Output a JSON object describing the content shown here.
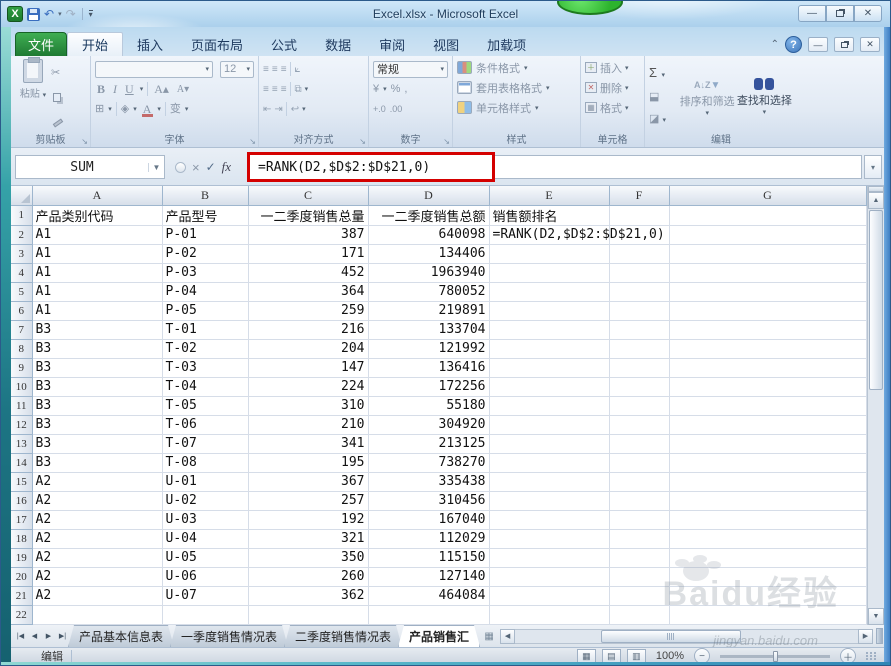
{
  "window": {
    "title": "Excel.xlsx - Microsoft Excel"
  },
  "ribbon": {
    "tabs": [
      {
        "label": "文件",
        "type": "file"
      },
      {
        "label": "开始",
        "active": true
      },
      {
        "label": "插入"
      },
      {
        "label": "页面布局"
      },
      {
        "label": "公式"
      },
      {
        "label": "数据"
      },
      {
        "label": "审阅"
      },
      {
        "label": "视图"
      },
      {
        "label": "加载项"
      }
    ],
    "clipboard": {
      "label": "剪贴板",
      "paste_label": "粘贴"
    },
    "font": {
      "label": "字体",
      "size": "12",
      "bold": "B",
      "italic": "I",
      "underline": "U",
      "color_letter": "A",
      "phonetic": "变"
    },
    "alignment": {
      "label": "对齐方式"
    },
    "number": {
      "label": "数字",
      "format": "常规",
      "currency": "¥",
      "percent": "%",
      "comma": ",",
      "inc_decimal": "+.0",
      "dec_decimal": ".00"
    },
    "styles": {
      "label": "样式",
      "items": [
        "条件格式",
        "套用表格格式",
        "单元格样式"
      ]
    },
    "cells": {
      "label": "单元格",
      "items": [
        "插入",
        "删除",
        "格式"
      ]
    },
    "editing": {
      "label": "编辑",
      "sum": "Σ",
      "sort_label": "排序和筛选",
      "find_label": "查找和选择"
    }
  },
  "formula_bar": {
    "name_box": "SUM",
    "formula": "=RANK(D2,$D$2:$D$21,0)",
    "fx_label": "fx"
  },
  "grid": {
    "column_headers": [
      "A",
      "B",
      "C",
      "D",
      "E",
      "F",
      "G"
    ],
    "numeric_columns": [
      2,
      3
    ],
    "rows": [
      {
        "n": 1,
        "cells": [
          "产品类别代码",
          "产品型号",
          "一二季度销售总量",
          "一二季度销售总额",
          "销售额排名",
          "",
          ""
        ]
      },
      {
        "n": 2,
        "cells": [
          "A1",
          "P-01",
          "387",
          "640098",
          "=RANK(D2,$D$2:$D$21,0)",
          "",
          ""
        ]
      },
      {
        "n": 3,
        "cells": [
          "A1",
          "P-02",
          "171",
          "134406",
          "",
          "",
          ""
        ]
      },
      {
        "n": 4,
        "cells": [
          "A1",
          "P-03",
          "452",
          "1963940",
          "",
          "",
          ""
        ]
      },
      {
        "n": 5,
        "cells": [
          "A1",
          "P-04",
          "364",
          "780052",
          "",
          "",
          ""
        ]
      },
      {
        "n": 6,
        "cells": [
          "A1",
          "P-05",
          "259",
          "219891",
          "",
          "",
          ""
        ]
      },
      {
        "n": 7,
        "cells": [
          "B3",
          "T-01",
          "216",
          "133704",
          "",
          "",
          ""
        ]
      },
      {
        "n": 8,
        "cells": [
          "B3",
          "T-02",
          "204",
          "121992",
          "",
          "",
          ""
        ]
      },
      {
        "n": 9,
        "cells": [
          "B3",
          "T-03",
          "147",
          "136416",
          "",
          "",
          ""
        ]
      },
      {
        "n": 10,
        "cells": [
          "B3",
          "T-04",
          "224",
          "172256",
          "",
          "",
          ""
        ]
      },
      {
        "n": 11,
        "cells": [
          "B3",
          "T-05",
          "310",
          "55180",
          "",
          "",
          ""
        ]
      },
      {
        "n": 12,
        "cells": [
          "B3",
          "T-06",
          "210",
          "304920",
          "",
          "",
          ""
        ]
      },
      {
        "n": 13,
        "cells": [
          "B3",
          "T-07",
          "341",
          "213125",
          "",
          "",
          ""
        ]
      },
      {
        "n": 14,
        "cells": [
          "B3",
          "T-08",
          "195",
          "738270",
          "",
          "",
          ""
        ]
      },
      {
        "n": 15,
        "cells": [
          "A2",
          "U-01",
          "367",
          "335438",
          "",
          "",
          ""
        ]
      },
      {
        "n": 16,
        "cells": [
          "A2",
          "U-02",
          "257",
          "310456",
          "",
          "",
          ""
        ]
      },
      {
        "n": 17,
        "cells": [
          "A2",
          "U-03",
          "192",
          "167040",
          "",
          "",
          ""
        ]
      },
      {
        "n": 18,
        "cells": [
          "A2",
          "U-04",
          "321",
          "112029",
          "",
          "",
          ""
        ]
      },
      {
        "n": 19,
        "cells": [
          "A2",
          "U-05",
          "350",
          "115150",
          "",
          "",
          ""
        ]
      },
      {
        "n": 20,
        "cells": [
          "A2",
          "U-06",
          "260",
          "127140",
          "",
          "",
          ""
        ]
      },
      {
        "n": 21,
        "cells": [
          "A2",
          "U-07",
          "362",
          "464084",
          "",
          "",
          ""
        ]
      },
      {
        "n": 22,
        "cells": [
          "",
          "",
          "",
          "",
          "",
          "",
          ""
        ]
      }
    ]
  },
  "sheet_bar": {
    "tabs": [
      {
        "label": "产品基本信息表"
      },
      {
        "label": "一季度销售情况表"
      },
      {
        "label": "二季度销售情况表"
      },
      {
        "label": "产品销售汇",
        "active": true
      }
    ]
  },
  "status_bar": {
    "mode": "编辑",
    "zoom_level": "100%"
  },
  "watermark": {
    "brand": "Baidu经验",
    "url": "jingyan.baidu.com"
  },
  "colors": {
    "annotation_red": "#d40000",
    "file_tab_green": "#2f9e41",
    "help_blue": "#3f77bb",
    "titlebar_blue": "#abd0ec"
  }
}
